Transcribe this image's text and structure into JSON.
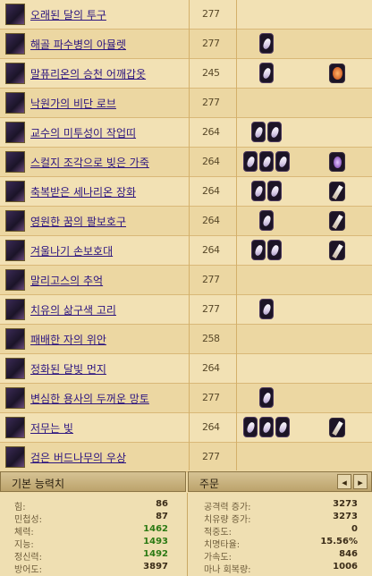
{
  "items": [
    {
      "name": "오래된 달의 투구",
      "level": "277",
      "gems": 0,
      "slot": ""
    },
    {
      "name": "해골 파수병의 아뮬렛",
      "level": "277",
      "gems": 1,
      "slot": ""
    },
    {
      "name": "말퓨리온의 승천 어깨갑옷",
      "level": "245",
      "gems": 1,
      "slot": "orange"
    },
    {
      "name": "낙원가의 비단 로브",
      "level": "277",
      "gems": 0,
      "slot": ""
    },
    {
      "name": "교수의 미투성이 작업띠",
      "level": "264",
      "gems": 2,
      "slot": ""
    },
    {
      "name": "스컬지 조각으로 빚은 가죽",
      "level": "264",
      "gems": 3,
      "slot": "purple"
    },
    {
      "name": "축복받은 세나리온 장화",
      "level": "264",
      "gems": 2,
      "slot": "white"
    },
    {
      "name": "영원한 꿈의 팔보호구",
      "level": "264",
      "gems": 1,
      "slot": "white"
    },
    {
      "name": "겨울나기 손보호대",
      "level": "264",
      "gems": 2,
      "slot": "white"
    },
    {
      "name": "말리고스의 추억",
      "level": "277",
      "gems": 0,
      "slot": ""
    },
    {
      "name": "치유의 삶구색 고리",
      "level": "277",
      "gems": 1,
      "slot": ""
    },
    {
      "name": "패배한 자의 위안",
      "level": "258",
      "gems": 0,
      "slot": ""
    },
    {
      "name": "정화된 달빛 먼지",
      "level": "264",
      "gems": 0,
      "slot": ""
    },
    {
      "name": "변심한 용사의 두꺼운 망토",
      "level": "277",
      "gems": 1,
      "slot": ""
    },
    {
      "name": "저무는 빛",
      "level": "264",
      "gems": 3,
      "slot": "white"
    },
    {
      "name": "검은 버드나무의 우상",
      "level": "277",
      "gems": 0,
      "slot": ""
    }
  ],
  "stats_panel": {
    "title": "기본 능력치"
  },
  "spec_panel": {
    "title": "주문",
    "prev": "◂",
    "next": "▸"
  },
  "stats_left": [
    {
      "label": "힘:",
      "value": "86",
      "green": false
    },
    {
      "label": "민첩성:",
      "value": "87",
      "green": false
    },
    {
      "label": "체력:",
      "value": "1462",
      "green": true
    },
    {
      "label": "지능:",
      "value": "1493",
      "green": true
    },
    {
      "label": "정신력:",
      "value": "1492",
      "green": true
    },
    {
      "label": "방어도:",
      "value": "3897",
      "green": false
    }
  ],
  "stats_right": [
    {
      "label": "공격력 증가:",
      "value": "3273"
    },
    {
      "label": "치유량 증가:",
      "value": "3273"
    },
    {
      "label": "적중도:",
      "value": "0"
    },
    {
      "label": "치명타율:",
      "value": "15.56%"
    },
    {
      "label": "가속도:",
      "value": "846"
    },
    {
      "label": "마나 회복량:",
      "value": "1006"
    }
  ]
}
